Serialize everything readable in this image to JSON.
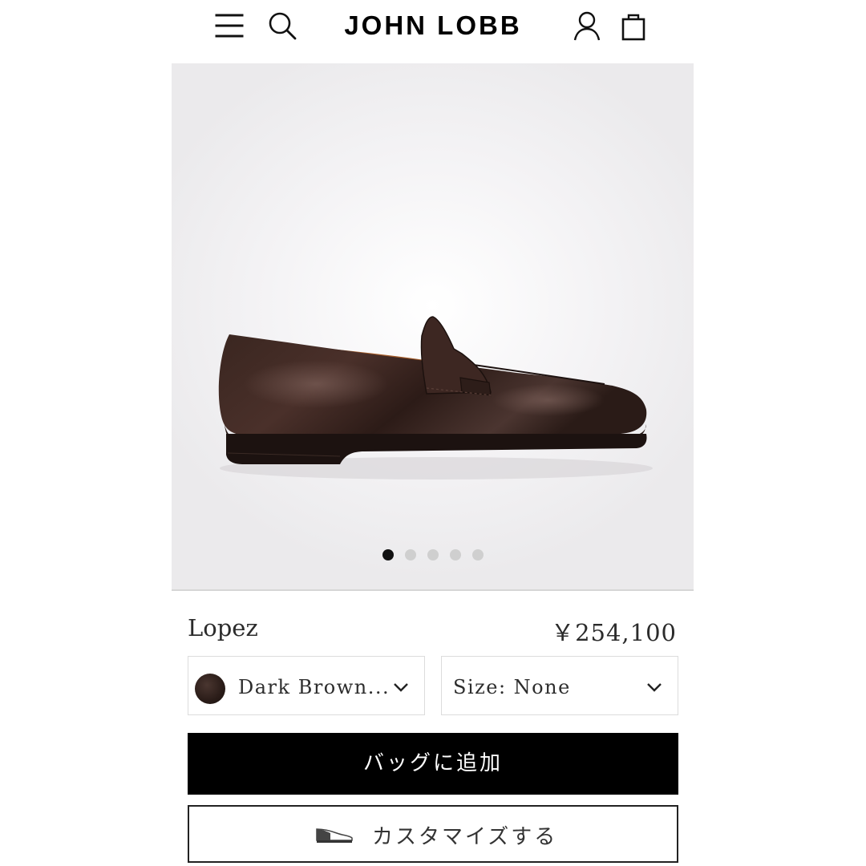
{
  "header": {
    "brand": "JOHN LOBB",
    "icons": [
      "menu-icon",
      "search-icon",
      "account-icon",
      "bag-icon"
    ]
  },
  "gallery": {
    "image": "dark-brown-penny-loafer",
    "slide_count": 5,
    "active_slide": 1
  },
  "product": {
    "name": "Lopez",
    "price": "￥254,100"
  },
  "options": {
    "color": {
      "label": "Dark Brown...",
      "swatch": "#2a1c18"
    },
    "size": {
      "label": "Size: None"
    }
  },
  "actions": {
    "add_to_bag": "バッグに追加",
    "customize": "カスタマイズする"
  },
  "colors": {
    "primary_button": "#000000",
    "gallery_bg": "#ebeaec",
    "active_dot": "#111111",
    "inactive_dot": "#cfcfcf"
  }
}
